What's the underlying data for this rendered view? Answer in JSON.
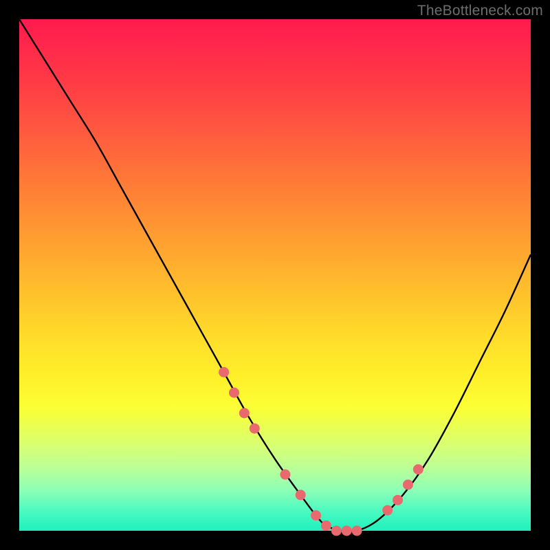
{
  "watermark": "TheBottleneck.com",
  "colors": {
    "gradient_top": "#ff1a4f",
    "gradient_mid": "#ffdc2a",
    "gradient_bottom": "#1ff0be",
    "curve": "#000000",
    "dot": "#e86a6f",
    "frame": "#000000"
  },
  "chart_data": {
    "type": "line",
    "title": "",
    "xlabel": "",
    "ylabel": "",
    "xlim": [
      0,
      100
    ],
    "ylim": [
      0,
      100
    ],
    "series": [
      {
        "name": "bottleneck-curve",
        "x": [
          0,
          5,
          10,
          15,
          20,
          25,
          30,
          35,
          40,
          45,
          50,
          55,
          58,
          60,
          63,
          66,
          70,
          75,
          80,
          85,
          90,
          95,
          100
        ],
        "y": [
          100,
          92,
          84,
          76,
          67,
          58,
          49,
          40,
          31,
          22,
          14,
          7,
          3,
          1,
          0,
          0,
          2,
          7,
          14,
          23,
          33,
          43,
          54
        ]
      }
    ],
    "highlight_points": {
      "name": "marker-dots",
      "x": [
        40,
        42,
        44,
        46,
        52,
        55,
        58,
        60,
        62,
        64,
        66,
        72,
        74,
        76,
        78
      ],
      "y": [
        31,
        27,
        23,
        20,
        11,
        7,
        3,
        1,
        0,
        0,
        0,
        4,
        6,
        9,
        12
      ]
    }
  }
}
